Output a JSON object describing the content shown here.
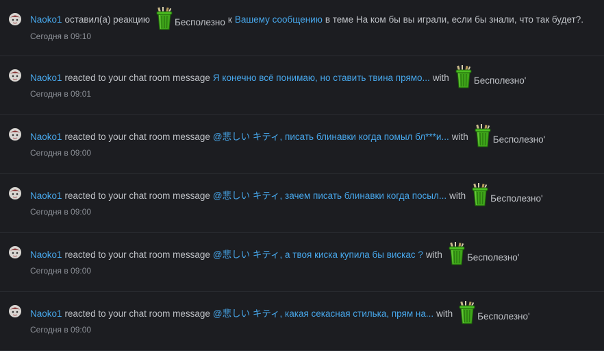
{
  "notifications": [
    {
      "user": "Naoko1",
      "action": "оставил(а) реакцию",
      "reaction_icon": "trash-bin-icon",
      "reaction_name": "Бесполезно",
      "prep": "к",
      "message": "Вашему сообщению",
      "suffix": "в теме На ком бы вы играли, если бы знали, что так будет?.",
      "time": "Сегодня в 09:10"
    },
    {
      "user": "Naoko1",
      "action": "reacted to your chat room message",
      "message": "Я конечно всё понимаю, но ставить твина прямо...",
      "with": "with",
      "reaction_icon": "trash-bin-icon",
      "reaction_name": "Бесполезно'",
      "time": "Сегодня в 09:01"
    },
    {
      "user": "Naoko1",
      "action": "reacted to your chat room message",
      "message": "@悲しい キティ, писать блинавки когда помыл бл***и...",
      "with": "with",
      "reaction_icon": "trash-bin-icon",
      "reaction_name": "Бесполезно'",
      "time": "Сегодня в 09:00"
    },
    {
      "user": "Naoko1",
      "action": "reacted to your chat room message",
      "message": "@悲しい キティ, зачем писать блинавки когда посыл...",
      "with": "with",
      "reaction_icon": "trash-bin-icon",
      "reaction_name": "Бесполезно'",
      "time": "Сегодня в 09:00"
    },
    {
      "user": "Naoko1",
      "action": "reacted to your chat room message",
      "message": "@悲しい キティ, а твоя киска купила бы вискас ?",
      "with": "with",
      "reaction_icon": "trash-bin-icon",
      "reaction_name": "Бесполезно'",
      "time": "Сегодня в 09:00"
    },
    {
      "user": "Naoko1",
      "action": "reacted to your chat room message",
      "message": "@悲しい キティ, какая секасная стилька, прям на...",
      "with": "with",
      "reaction_icon": "trash-bin-icon",
      "reaction_name": "Бесполезно'",
      "time": "Сегодня в 09:00"
    }
  ],
  "colors": {
    "background": "#1c1d21",
    "link": "#47a7eb",
    "text": "#bfc2c7",
    "muted": "#8c9097",
    "divider": "#2b2d32",
    "trash_green": "#3fa51a"
  }
}
